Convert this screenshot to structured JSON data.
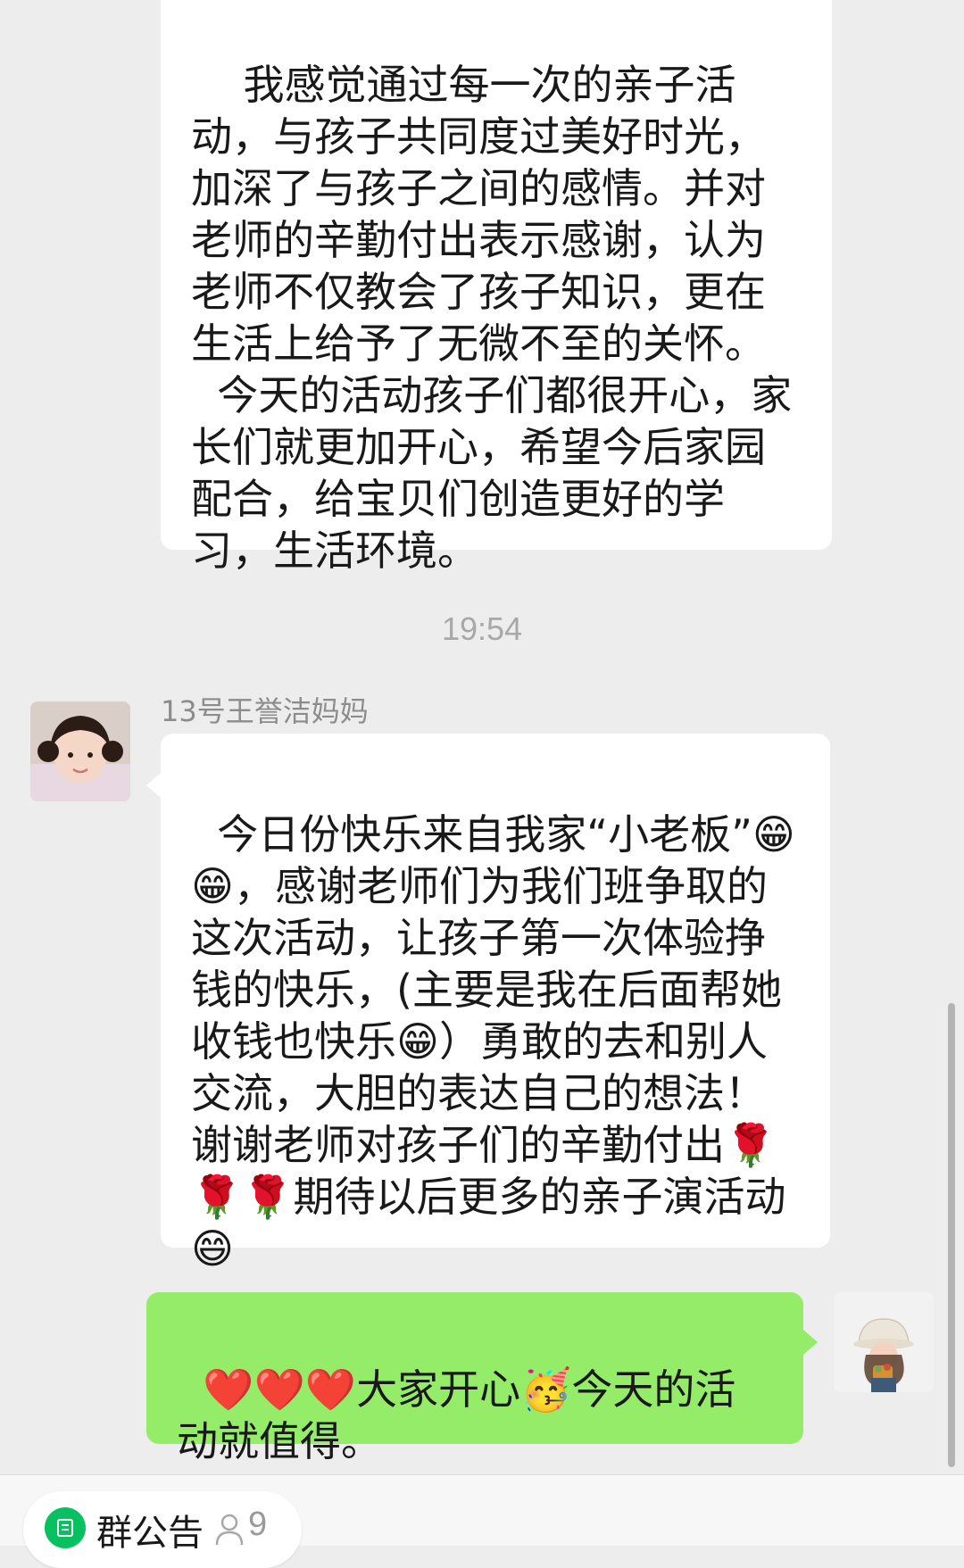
{
  "messages": {
    "previous": {
      "text": "  我感觉通过每一次的亲子活动，与孩子共同度过美好时光，加深了与孩子之间的感情。并对老师的辛勤付出表示感谢，认为老师不仅教会了孩子知识，更在生活上给予了无微不至的关怀。\n  今天的活动孩子们都很开心，家长们就更加开心，希望今后家园配合，给宝贝们创造更好的学习，生活环境。"
    },
    "timestamp": "19:54",
    "received": {
      "sender": "13号王誉洁妈妈",
      "text": "今日份快乐来自我家“小老板”😁😁，感谢老师们为我们班争取的这次活动，让孩子第一次体验挣钱的快乐，(主要是我在后面帮她收钱也快乐😁）勇敢的去和别人交流，大胆的表达自己的想法！谢谢老师对孩子们的辛勤付出🌹🌹🌹期待以后更多的亲子演活动😄"
    },
    "sent": {
      "text": "❤️❤️❤️大家开心🥳今天的活动就值得。"
    }
  },
  "bottom_bar": {
    "notice_label": "群公告",
    "member_count": "9"
  },
  "colors": {
    "background": "#ededed",
    "sent_bubble": "#95ec69",
    "received_bubble": "#ffffff",
    "accent": "#07c160"
  },
  "icons": {
    "notice": "announcement-icon",
    "members": "person-icon"
  }
}
